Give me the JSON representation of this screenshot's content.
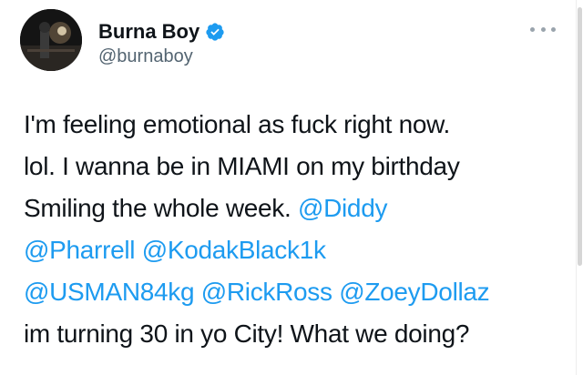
{
  "author": {
    "display_name": "Burna Boy",
    "handle": "@burnaboy",
    "verified_icon": "verified-badge-icon",
    "verified_color": "#1d9bf0"
  },
  "menu": {
    "icon": "more-options-icon"
  },
  "tweet": {
    "line1": "I'm feeling emotional as fuck right now.",
    "line2": "lol. I wanna be in MIAMI on my birthday",
    "line3_text": "Smiling the whole week. ",
    "line3_mention": "@Diddy",
    "line4_mention1": "@Pharrell",
    "line4_sep": " ",
    "line4_mention2": "@KodakBlack1k",
    "line5_mention1": "@USMAN84kg",
    "line5_sep1": " ",
    "line5_mention2": "@RickRoss",
    "line5_sep2": " ",
    "line5_mention3": "@ZoeyDollaz",
    "line6": "im turning 30 in yo City! What we doing?"
  },
  "colors": {
    "text": "#0f1419",
    "mention": "#1d9bf0",
    "secondary": "#536471"
  }
}
